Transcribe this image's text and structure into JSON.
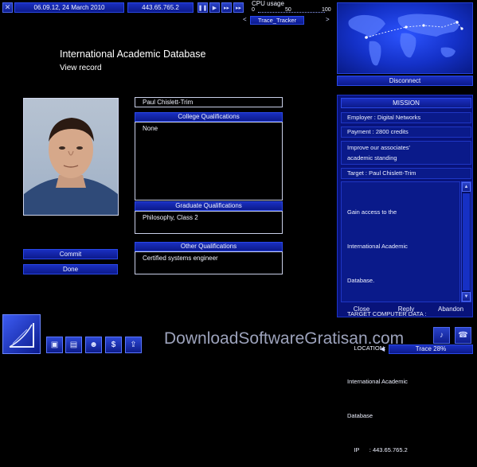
{
  "topbar": {
    "datetime": "06.09.12, 24 March 2010",
    "ip": "443.65.765.2",
    "cpu_label": "CPU usage",
    "cpu_scale": [
      "0",
      "50",
      "100"
    ],
    "trace_program": "Trace_Tracker"
  },
  "map": {
    "disconnect_label": "Disconnect"
  },
  "record": {
    "title": "International Academic Database",
    "subtitle": "View record",
    "name": "Paul Chislett-Trim",
    "college_header": "College Qualifications",
    "college_value": "None",
    "graduate_header": "Graduate Qualifications",
    "graduate_value": "Philosophy, Class 2",
    "other_header": "Other Qualifications",
    "other_value": "Certified systems engineer",
    "commit_label": "Commit",
    "done_label": "Done"
  },
  "mission": {
    "header": "MISSION",
    "employer": "Employer : Digital Networks",
    "payment": "Payment : 2800 credits",
    "goal_line1": "Improve our associates'",
    "goal_line2": "academic standing",
    "target": "Target : Paul Chislett-Trim",
    "details": [
      "Gain access to the",
      "International Academic",
      "Database.",
      "TARGET COMPUTER DATA :",
      "    LOCATION:",
      "International Academic",
      "Database",
      "    IP      : 443.65.765.2"
    ],
    "close_label": "Close",
    "reply_label": "Reply",
    "abandon_label": "Abandon"
  },
  "statusbar": {
    "trace_label": "Trace 28%"
  },
  "watermark": "DownloadSoftwareGratisan.com",
  "colors": {
    "accent": "#1327b8",
    "panel": "#0a1a8a",
    "text": "#eef1ff"
  },
  "icons": [
    "system-icon",
    "memory-icon",
    "disk-icon",
    "people-icon",
    "dollar-icon",
    "upload-icon",
    "sound-icon"
  ]
}
